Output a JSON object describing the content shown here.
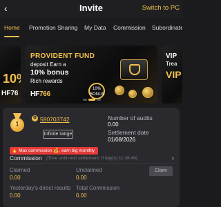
{
  "header": {
    "title": "Invite",
    "switch_label": "Switch to PC"
  },
  "tabs": [
    {
      "label": "Home"
    },
    {
      "label": "Promotion Sharing"
    },
    {
      "label": "My Data"
    },
    {
      "label": "Commission"
    },
    {
      "label": "Subordinate"
    }
  ],
  "active_tab": "Home",
  "banner": {
    "center": {
      "title": "PROVIDENT FUND",
      "line1": "deposit Earn a",
      "line2": "10% bonus",
      "line3": "Rich rewards",
      "logo_main": "HF",
      "logo_num": "766",
      "badge_pct": "10%",
      "badge_word": "BONUS"
    },
    "left": {
      "big": "10%",
      "logo": "HF76"
    },
    "right": {
      "line1": "VIP",
      "line2": "Trea",
      "line3": "VIP"
    },
    "active_slide_index": 1,
    "slide_count": 3
  },
  "card": {
    "level": "1",
    "user_id": "580703742",
    "range_label": "Infinite range",
    "audits_label": "Number of audits",
    "audits_value": "0.00",
    "settlement_label": "Settlement date",
    "settlement_value": "01/08/2026",
    "promo_text": "Max commission 💰, earn big monthly",
    "commission_title": "Commission",
    "commission_time": "(Time until next settlement: 0 day(s) 11:38:49)",
    "claimed_label": "Claimed",
    "claimed_value": "0.00",
    "unclaimed_label": "Unclaimed",
    "unclaimed_value": "0.00",
    "claim_button": "Claim",
    "yesterday_label": "Yesterday's direct results",
    "yesterday_value": "0.00",
    "total_label": "Total Commission",
    "total_value": "0.00"
  },
  "colors": {
    "accent": "#f2c14e",
    "background": "#1b1b1e",
    "card": "#2a2a2e",
    "promo": "#e33a3a"
  }
}
